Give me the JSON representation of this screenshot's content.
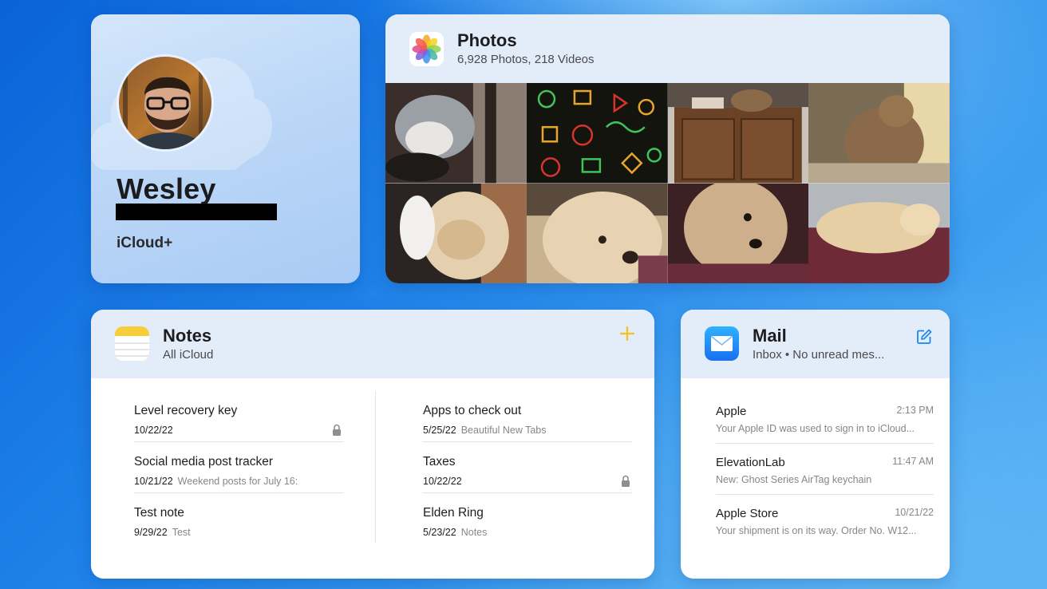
{
  "profile": {
    "name": "Wesley",
    "plan": "iCloud+"
  },
  "photos": {
    "title": "Photos",
    "subtitle": "6,928 Photos, 218 Videos",
    "icon": "photos-app-icon",
    "thumbnails": [
      "cat-by-window",
      "colorful-doodle-pattern",
      "cat-on-cabinet",
      "cat-sitting",
      "dog-on-blanket",
      "dog-closeup",
      "dog-looking-down",
      "dog-lying-on-couch"
    ]
  },
  "notes": {
    "title": "Notes",
    "subtitle": "All iCloud",
    "add_icon": "plus-icon",
    "left": [
      {
        "title": "Level recovery key",
        "date": "10/22/22",
        "preview": "",
        "locked": true
      },
      {
        "title": "Social media post tracker",
        "date": "10/21/22",
        "preview": "Weekend posts for July 16:",
        "locked": false
      },
      {
        "title": "Test note",
        "date": "9/29/22",
        "preview": "Test",
        "locked": false
      }
    ],
    "right": [
      {
        "title": "Apps to check out",
        "date": "5/25/22",
        "preview": "Beautiful New Tabs",
        "locked": false
      },
      {
        "title": "Taxes",
        "date": "10/22/22",
        "preview": "",
        "locked": true
      },
      {
        "title": "Elden Ring",
        "date": "5/23/22",
        "preview": "Notes",
        "locked": false
      }
    ]
  },
  "mail": {
    "title": "Mail",
    "subtitle": "Inbox • No unread mes...",
    "compose_icon": "compose-icon",
    "messages": [
      {
        "from": "Apple",
        "time": "2:13 PM",
        "preview": "Your Apple ID was used to sign in to iCloud..."
      },
      {
        "from": "ElevationLab",
        "time": "11:47 AM",
        "preview": "New: Ghost Series AirTag keychain"
      },
      {
        "from": "Apple Store",
        "time": "10/21/22",
        "preview": "Your shipment is on its way. Order No. W12..."
      }
    ]
  },
  "colors": {
    "background": "#1f83ea",
    "card_header": "#e3edfa",
    "notes_accent": "#f3c233",
    "mail_accent": "#1a84f0"
  }
}
